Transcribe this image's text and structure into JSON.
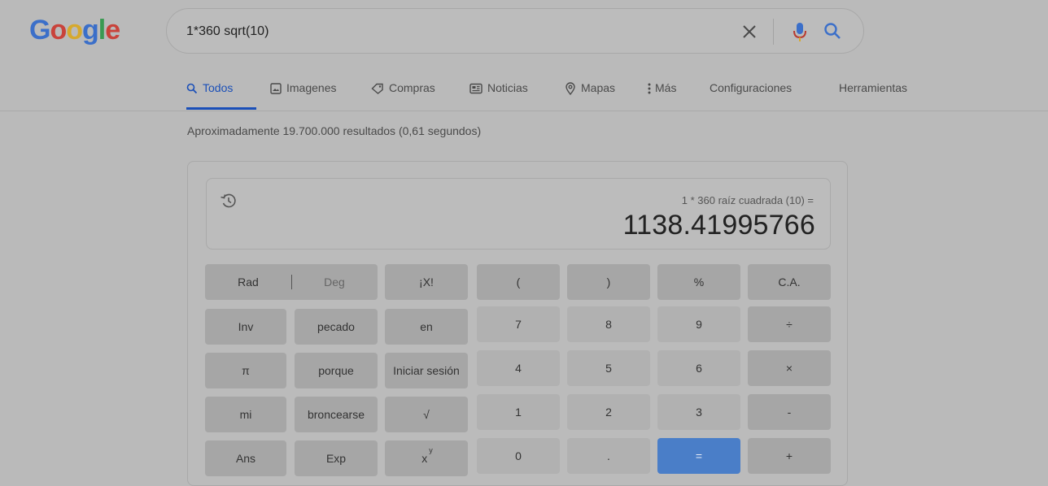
{
  "logo": {
    "letters": [
      "G",
      "o",
      "o",
      "g",
      "l",
      "e"
    ],
    "colors": [
      "#3b6fc9",
      "#c9433b",
      "#d6a92d",
      "#3b6fc9",
      "#3a9a52",
      "#c9433b"
    ]
  },
  "search": {
    "query": "1*360 sqrt(10)"
  },
  "icons": {
    "clear": "close-icon",
    "mic": "microphone-icon",
    "search": "search-icon",
    "history": "history-icon"
  },
  "nav": {
    "tabs": [
      {
        "label": "Todos",
        "icon": "search-icon",
        "active": true
      },
      {
        "label": "Imagenes",
        "icon": "image-icon"
      },
      {
        "label": "Compras",
        "icon": "tag-icon"
      },
      {
        "label": "Noticias",
        "icon": "news-icon"
      },
      {
        "label": "Mapas",
        "icon": "map-pin-icon"
      },
      {
        "label": "Más",
        "icon": "more-icon"
      }
    ],
    "settings": "Configuraciones",
    "tools": "Herramientas"
  },
  "stats": "Aproximadamente 19.700.000 resultados (0,61 segundos)",
  "calculator": {
    "expression": "1 * 360 raíz cuadrada (10) =",
    "result": "1138.41995766",
    "rad": "Rad",
    "deg": "Deg",
    "keys": {
      "fact": "¡X!",
      "lparen": "(",
      "rparen": ")",
      "percent": "%",
      "ca": "C.A.",
      "inv": "Inv",
      "sin": "pecado",
      "ln": "en",
      "seven": "7",
      "eight": "8",
      "nine": "9",
      "divide": "÷",
      "pi": "π",
      "cos": "porque",
      "log": "Iniciar sesión",
      "four": "4",
      "five": "5",
      "six": "6",
      "multiply": "×",
      "e": "mi",
      "tan": "broncearse",
      "sqrt": "√",
      "one": "1",
      "two": "2",
      "three": "3",
      "minus": "-",
      "ans": "Ans",
      "exp": "Exp",
      "pow_base": "x",
      "pow_exp": "y",
      "zero": "0",
      "dot": ".",
      "equals": "=",
      "plus": "+"
    }
  },
  "colors": {
    "accent": "#1a4fb8",
    "equals_key": "#4a7ec8",
    "mic_red": "#b83a30",
    "mic_blue": "#3b6fc9"
  }
}
